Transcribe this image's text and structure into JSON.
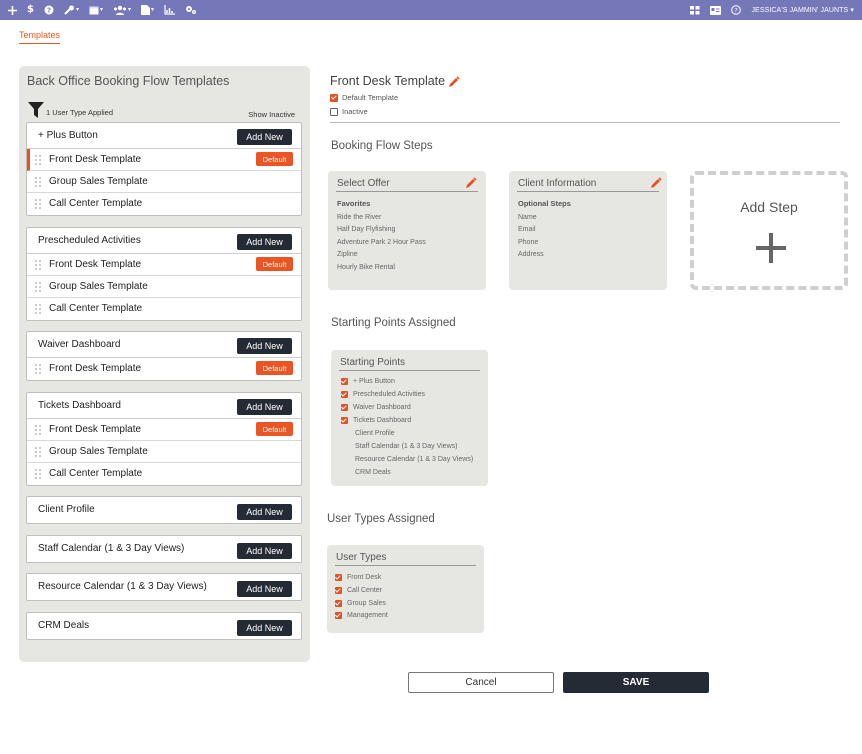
{
  "topnav": {
    "icons": [
      "plus-icon",
      "dollar-icon",
      "help-circle-icon",
      "wrench-icon",
      "calendar-icon",
      "users-icon",
      "document-icon",
      "chart-icon",
      "settings-icon"
    ],
    "right_icons": [
      "grid-icon",
      "card-icon",
      "help-circle-icon"
    ],
    "user_label": "JESSICA'S JAMMIN' JAUNTS",
    "bar_color": "#7577b9"
  },
  "tabs": {
    "templates": "Templates"
  },
  "left": {
    "title": "Back Office Booking Flow Templates",
    "filter_label": "1 User Type Applied",
    "show_inactive": "Show Inactive",
    "add_label": "Add New",
    "default_label": "Default",
    "groups": [
      {
        "title": "+ Plus Button",
        "rows": [
          "Front Desk Template",
          "Group Sales Template",
          "Call Center Template"
        ]
      },
      {
        "title": "Prescheduled Activities",
        "rows": [
          "Front Desk Template",
          "Group Sales Template",
          "Call Center Template"
        ]
      },
      {
        "title": "Waiver Dashboard",
        "rows": [
          "Front Desk Template"
        ]
      },
      {
        "title": "Tickets Dashboard",
        "rows": [
          "Front Desk Template",
          "Group Sales Template",
          "Call Center Template"
        ]
      },
      {
        "title": "Client Profile",
        "rows": []
      },
      {
        "title": "Staff Calendar (1 & 3 Day Views)",
        "rows": []
      },
      {
        "title": "Resource Calendar (1 & 3 Day Views)",
        "rows": []
      },
      {
        "title": "CRM Deals",
        "rows": []
      }
    ]
  },
  "detail": {
    "title": "Front Desk Template",
    "default_template": "Default Template",
    "inactive": "Inactive",
    "steps_heading": "Booking Flow Steps",
    "select_offer": {
      "title": "Select Offer",
      "subtitle": "Favorites",
      "items": [
        "Ride the River",
        "Half Day Flyfishing",
        "Adventure Park 2 Hour Pass",
        "Zipline",
        "Hourly Bike Rental"
      ]
    },
    "client_info": {
      "title": "Client Information",
      "subtitle": "Optional Steps",
      "items": [
        "Name",
        "Email",
        "Phone",
        "Address"
      ]
    },
    "add_step": "Add Step",
    "starting_heading": "Starting Points Assigned",
    "starting": {
      "title": "Starting Points",
      "checked": [
        "+ Plus Button",
        "Prescheduled Activities",
        "Waiver Dashboard",
        "Tickets Dashboard"
      ],
      "unchecked": [
        "Client Profile",
        "Staff Calendar (1 & 3 Day Views)",
        "Resource Calendar (1 & 3 Day Views)",
        "CRM Deals"
      ]
    },
    "usertypes_heading": "User Types Assigned",
    "usertypes": {
      "title": "User Types",
      "checked": [
        "Front Desk",
        "Call Center",
        "Group Sales",
        "Management"
      ]
    }
  },
  "actions": {
    "cancel": "Cancel",
    "save": "SAVE"
  },
  "colors": {
    "accent": "#e8501f",
    "dark_button": "#252b35",
    "panel": "#e6e7e2"
  }
}
